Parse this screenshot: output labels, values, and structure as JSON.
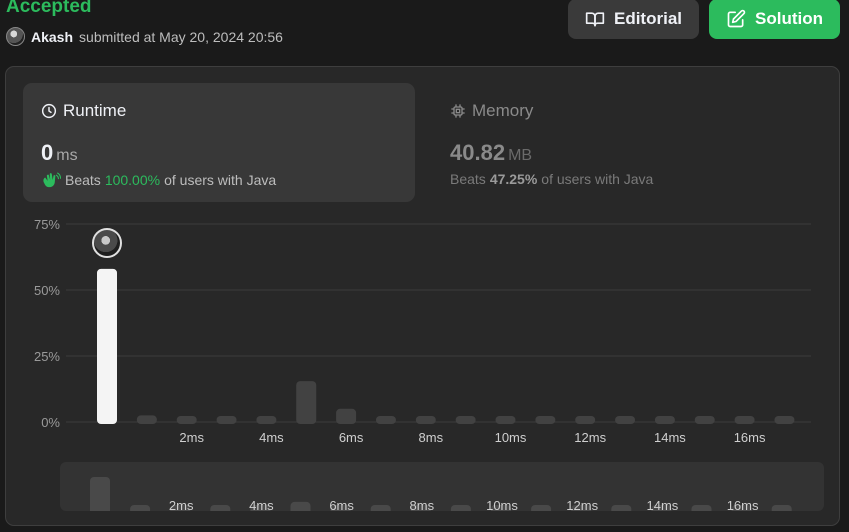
{
  "header": {
    "status": "Accepted",
    "user": "Akash",
    "submitted_text": "submitted at May 20, 2024 20:56",
    "editorial_label": "Editorial",
    "solution_label": "Solution"
  },
  "runtime": {
    "title": "Runtime",
    "value": "0",
    "unit": "ms",
    "beats_prefix": "Beats",
    "beats_pct": "100.00%",
    "beats_suffix": "of users with Java"
  },
  "memory": {
    "title": "Memory",
    "value": "40.82",
    "unit": "MB",
    "beats_prefix": "Beats",
    "beats_pct": "47.25%",
    "beats_suffix": "of users with Java"
  },
  "colors": {
    "accent_green": "#2cbb5d",
    "highlight_bar": "#f4f4f4",
    "bar": "#424242"
  },
  "chart_data": {
    "type": "bar",
    "x": [
      0,
      1,
      2,
      3,
      4,
      5,
      6,
      7,
      8,
      9,
      10,
      11,
      12,
      13,
      14,
      15,
      16,
      17
    ],
    "values": [
      58,
      2.5,
      1.5,
      1.5,
      1.5,
      15.5,
      5,
      1.5,
      1.5,
      1.5,
      1.5,
      1.5,
      1.5,
      1.5,
      1.5,
      1.5,
      1.5,
      1.5
    ],
    "highlight_index": 0,
    "y_ticks": [
      "0%",
      "25%",
      "50%",
      "75%"
    ],
    "ylim": [
      0,
      75
    ],
    "x_ticks": [
      "2ms",
      "4ms",
      "6ms",
      "8ms",
      "10ms",
      "12ms",
      "14ms",
      "16ms"
    ],
    "grid": true
  }
}
